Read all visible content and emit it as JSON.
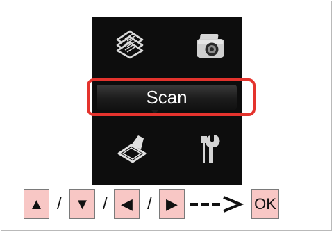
{
  "lcd": {
    "menu_icons": [
      "copy-icon",
      "photo-icon",
      "scan-icon",
      "setup-icon"
    ],
    "selected_label": "Scan"
  },
  "nav": {
    "up_key": "▲",
    "down_key": "▼",
    "left_key": "◀",
    "right_key": "▶",
    "separator": "/",
    "ok_key": "OK"
  },
  "colors": {
    "highlight": "#e4332d",
    "key_fill": "#f8c7c5",
    "lcd_bg": "#0d0d0d"
  }
}
